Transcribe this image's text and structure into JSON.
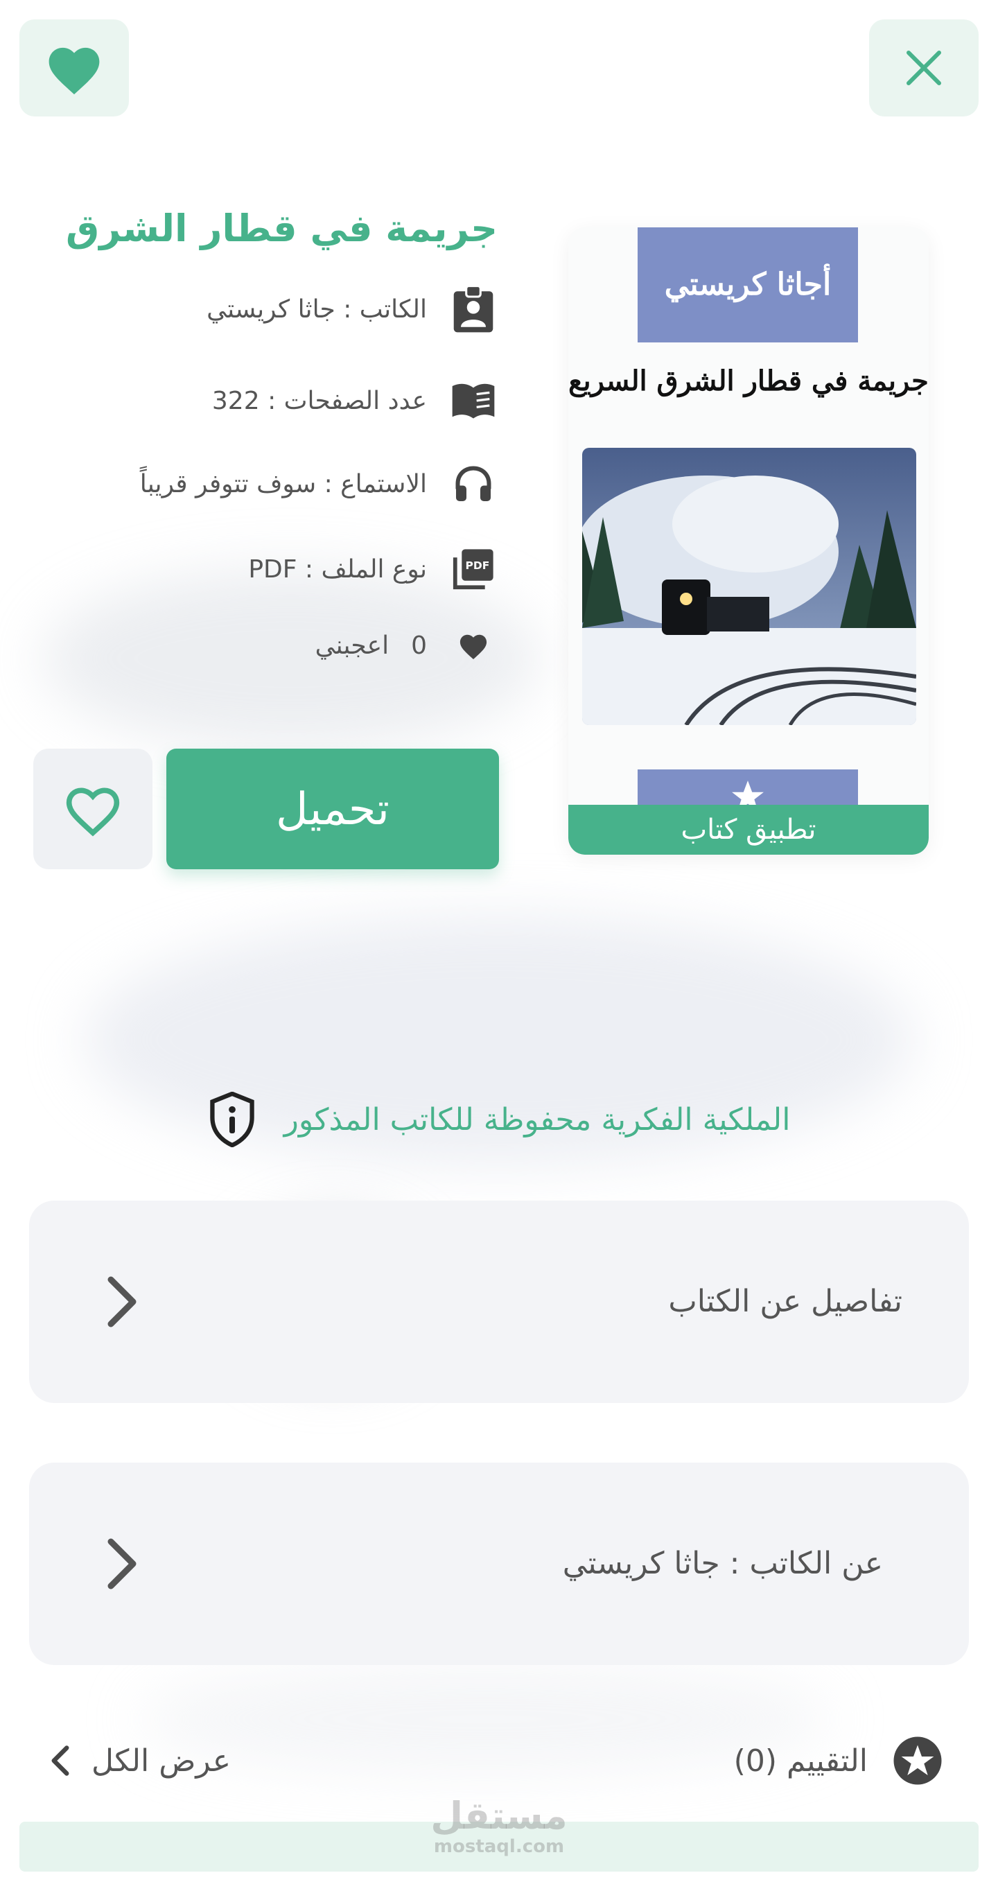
{
  "header": {
    "close_icon": "close-icon",
    "favorite_icon": "heart-filled-icon"
  },
  "cover": {
    "brand": "أجاثا كريستي",
    "title": "جريمة في قطار الشرق السريع",
    "ribbon": "تطبيق كتاب"
  },
  "book": {
    "title": "جريمة في قطار الشرق",
    "author_label": "الكاتب : جاثا كريستي",
    "pages_label": "عدد الصفحات : 322",
    "audio_label": "الاستماع : سوف تتوفر قريباً",
    "filetype_label": "نوع الملف : PDF",
    "likes_count": "0",
    "likes_label": "اعجبني"
  },
  "actions": {
    "download_label": "تحميل"
  },
  "copyright": {
    "text": "الملكية الفكرية محفوظة للكاتب المذكور"
  },
  "panels": {
    "details_label": "تفاصيل عن الكتاب",
    "author_label": "عن الكاتب  :  جاثا كريستي"
  },
  "rating": {
    "label": "التقييم (0)",
    "view_all": "عرض الكل"
  },
  "watermark": {
    "brand": "مستقل",
    "site": "mostaql.com"
  },
  "colors": {
    "accent": "#47b28b",
    "accent_light": "#eaf5f0",
    "panel": "#f3f4f7",
    "cover_band": "#7e8fc6"
  }
}
